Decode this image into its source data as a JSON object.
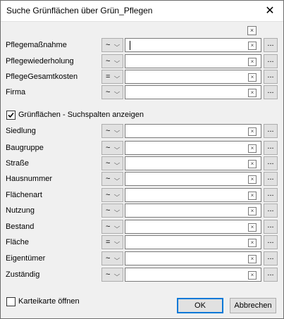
{
  "window": {
    "title": "Suche Grünflächen über Grün_Pflegen",
    "close_glyph": "✕"
  },
  "clear_all_glyph": "×",
  "clear_glyph": "×",
  "more_label": "...",
  "top_fields": [
    {
      "label": "Pflegemaßnahme",
      "op": "~",
      "value": ""
    },
    {
      "label": "Pflegewiederholung",
      "op": "~",
      "value": ""
    },
    {
      "label": "PflegeGesamtkosten",
      "op": "=",
      "value": ""
    },
    {
      "label": "Firma",
      "op": "~",
      "value": ""
    }
  ],
  "show_columns": {
    "label": "Grünflächen - Suchspalten anzeigen",
    "checked": true
  },
  "bottom_fields": [
    {
      "label": "Siedlung",
      "op": "~",
      "value": ""
    },
    {
      "label": "Baugruppe",
      "op": "~",
      "value": ""
    },
    {
      "label": "Straße",
      "op": "~",
      "value": ""
    },
    {
      "label": "Hausnummer",
      "op": "~",
      "value": ""
    },
    {
      "label": "Flächenart",
      "op": "~",
      "value": ""
    },
    {
      "label": "Nutzung",
      "op": "~",
      "value": ""
    },
    {
      "label": "Bestand",
      "op": "~",
      "value": ""
    },
    {
      "label": "Fläche",
      "op": "=",
      "value": ""
    },
    {
      "label": "Eigentümer",
      "op": "~",
      "value": ""
    },
    {
      "label": "Zuständig",
      "op": "~",
      "value": ""
    }
  ],
  "index_card": {
    "label": "Karteikarte öffnen",
    "checked": false
  },
  "buttons": {
    "ok": "OK",
    "cancel": "Abbrechen"
  },
  "chevron_glyph": "⌵"
}
